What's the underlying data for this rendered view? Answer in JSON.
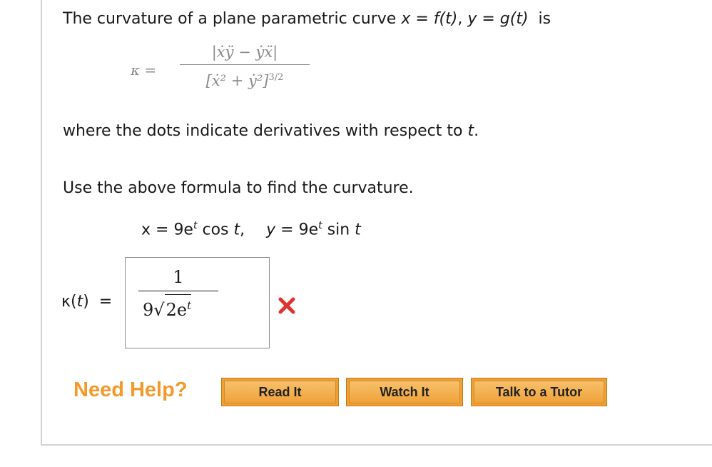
{
  "intro": {
    "text_a": "The curvature of a plane parametric curve ",
    "x_var": "x",
    "eq1": " = ",
    "f_of_t": "f(t)",
    "comma": ", ",
    "y_var": "y",
    "eq2": " = ",
    "g_of_t": "g(t)",
    "text_b": "  is"
  },
  "formula": {
    "lhs": "κ =",
    "numerator": "|ẋÿ − ẏẍ|",
    "denominator": "[ẋ² + ẏ²]",
    "exponent": "3/2"
  },
  "where": {
    "text": "where the dots indicate derivatives with respect to ",
    "var": "t",
    "period": "."
  },
  "instruction": "Use the above formula to find the curvature.",
  "parametric": {
    "x_part": "x = 9e",
    "x_exp": "t",
    "x_trig": " cos ",
    "x_var": "t",
    "x_comma": ",",
    "y_part": "y",
    "y_eq": " = 9e",
    "y_exp": "t",
    "y_trig": " sin ",
    "y_var": "t"
  },
  "answer": {
    "label_kappa": "κ(",
    "label_t": "t",
    "label_rest": ")  =",
    "numerator": "1",
    "coef": "9",
    "radical_sign": "√",
    "radicand": "2e",
    "radicand_exp": "t",
    "status": "incorrect",
    "status_color": "#e0312f"
  },
  "help": {
    "label": "Need Help?",
    "buttons": {
      "read": "Read It",
      "watch": "Watch It",
      "tutor": "Talk to a Tutor"
    },
    "label_color": "#f39a2b",
    "button_color": "#f0a033"
  }
}
